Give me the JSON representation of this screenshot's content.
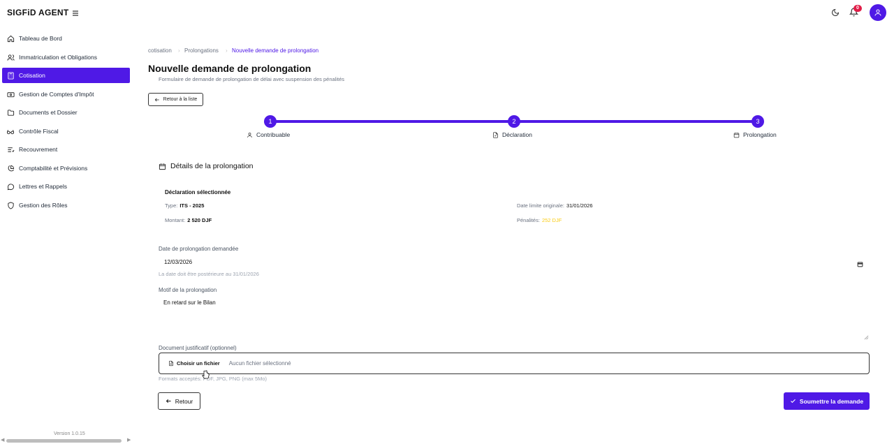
{
  "app": {
    "brand": "SIGFiD AGENT",
    "notifications_count": "0",
    "accent": "#4f19e6"
  },
  "sidebar": {
    "items": [
      {
        "label": "Tableau de Bord",
        "icon": "home-icon"
      },
      {
        "label": "Immatriculation et Obligations",
        "icon": "users-icon"
      },
      {
        "label": "Cotisation",
        "icon": "calculator-icon",
        "active": true
      },
      {
        "label": "Gestion de Comptes d'Impôt",
        "icon": "wallet-icon"
      },
      {
        "label": "Documents et Dossier",
        "icon": "folder-icon"
      },
      {
        "label": "Contrôle Fiscal",
        "icon": "glasses-icon"
      },
      {
        "label": "Recouvrement",
        "icon": "list-icon"
      },
      {
        "label": "Comptabilité et Prévisions",
        "icon": "pie-chart-icon"
      },
      {
        "label": "Lettres et Rappels",
        "icon": "message-icon"
      },
      {
        "label": "Gestion des Rôles",
        "icon": "shield-icon"
      }
    ],
    "version": "Version 1.0.15"
  },
  "breadcrumb": [
    "cotisation",
    "Prolongations",
    "Nouvelle demande de prolongation"
  ],
  "page": {
    "title": "Nouvelle demande de prolongation",
    "subtitle": "Formulaire de demande de prolongation de délai avec suspension des pénalités",
    "back_to_list": "Retour à la liste"
  },
  "steps": [
    {
      "number": "1",
      "label": "Contribuable"
    },
    {
      "number": "2",
      "label": "Déclaration"
    },
    {
      "number": "3",
      "label": "Prolongation"
    }
  ],
  "details": {
    "section_title": "Détails de la prolongation",
    "declaration_heading": "Déclaration sélectionnée",
    "type_label": "Type:",
    "type_value": "ITS - 2025",
    "amount_label": "Montant:",
    "amount_value": "2 520 DJF",
    "deadline_label": "Date limite originale:",
    "deadline_value": "31/01/2026",
    "penalties_label": "Pénalités:",
    "penalties_value": "252 DJF"
  },
  "form": {
    "date_label": "Date de prolongation demandée",
    "date_value": "12/03/2026",
    "date_hint": "La date doit être postérieure au 31/01/2026",
    "motif_label": "Motif de la prolongation",
    "motif_value": "En retard sur le Bilan",
    "doc_label": "Document justificatif (optionnel)",
    "choose_file": "Choisir un fichier",
    "no_file": "Aucun fichier sélectionné",
    "formats": "Formats acceptés: PDF, JPG, PNG (max 5Mo)"
  },
  "actions": {
    "back": "Retour",
    "submit": "Soumettre la demande"
  }
}
